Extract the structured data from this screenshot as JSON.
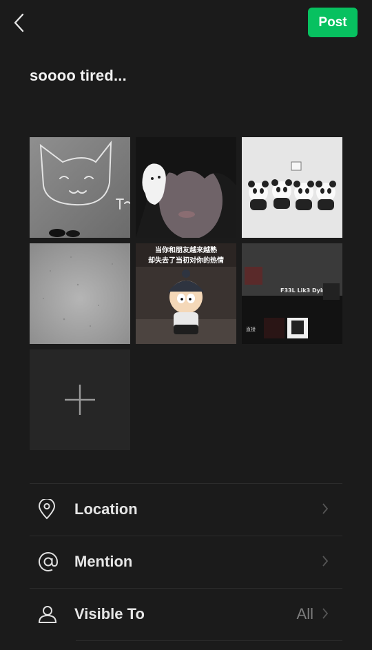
{
  "header": {
    "back_icon": "chevron-left-icon",
    "post_label": "Post",
    "accent_color": "#07c160"
  },
  "caption": "soooo tired...",
  "photos": {
    "items": [
      {
        "subject": "chalk cat drawing",
        "text": "T~T"
      },
      {
        "subject": "face selfie with ghost doodle",
        "text": ""
      },
      {
        "subject": "panda keychains",
        "text": ""
      },
      {
        "subject": "gray textured surface",
        "text": ""
      },
      {
        "subject": "cartoon boy meme",
        "text": "当你和朋友越来越熟\n 却失去了当初对你的热情"
      },
      {
        "subject": "music app screenshot",
        "text": "F33L Lik3 Dyin"
      }
    ],
    "add_icon": "plus-icon"
  },
  "options": [
    {
      "icon": "location-pin-icon",
      "label": "Location",
      "value": ""
    },
    {
      "icon": "at-sign-icon",
      "label": "Mention",
      "value": ""
    },
    {
      "icon": "person-icon",
      "label": "Visible To",
      "value": "All"
    }
  ]
}
